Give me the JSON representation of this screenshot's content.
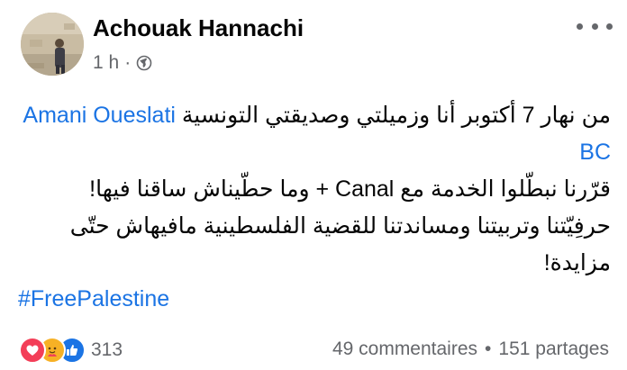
{
  "post": {
    "author": "Achouak Hannachi",
    "time": "1 h",
    "separator": "·",
    "privacy_icon": "globe-icon",
    "more_icon": "more-horizontal-icon",
    "text": {
      "line1_prefix": "من نهار 7 أكتوبر أنا وزميلتي وصديقتي التونسية ",
      "mention": "Amani Oueslati BC",
      "para2": "قرّرنا نبطّلوا الخدمة مع Canal + وما حطّيناش ساقنا فيها!",
      "para3": "حرفِيّتنا وتربيتنا ومساندتنا للقضية الفلسطينية مافيهاش حتّى مزايدة!"
    },
    "hashtag": "#FreePalestine"
  },
  "footer": {
    "reaction_icons": [
      "love-icon",
      "care-icon",
      "like-icon"
    ],
    "reaction_count": "313",
    "comments": "49 commentaires",
    "dot": "•",
    "shares": "151 partages"
  },
  "colors": {
    "link": "#1b74e4",
    "secondary_text": "#65676b",
    "text": "#050505",
    "love": "#f33e58",
    "care": "#f7b125",
    "like": "#1b74e4"
  }
}
